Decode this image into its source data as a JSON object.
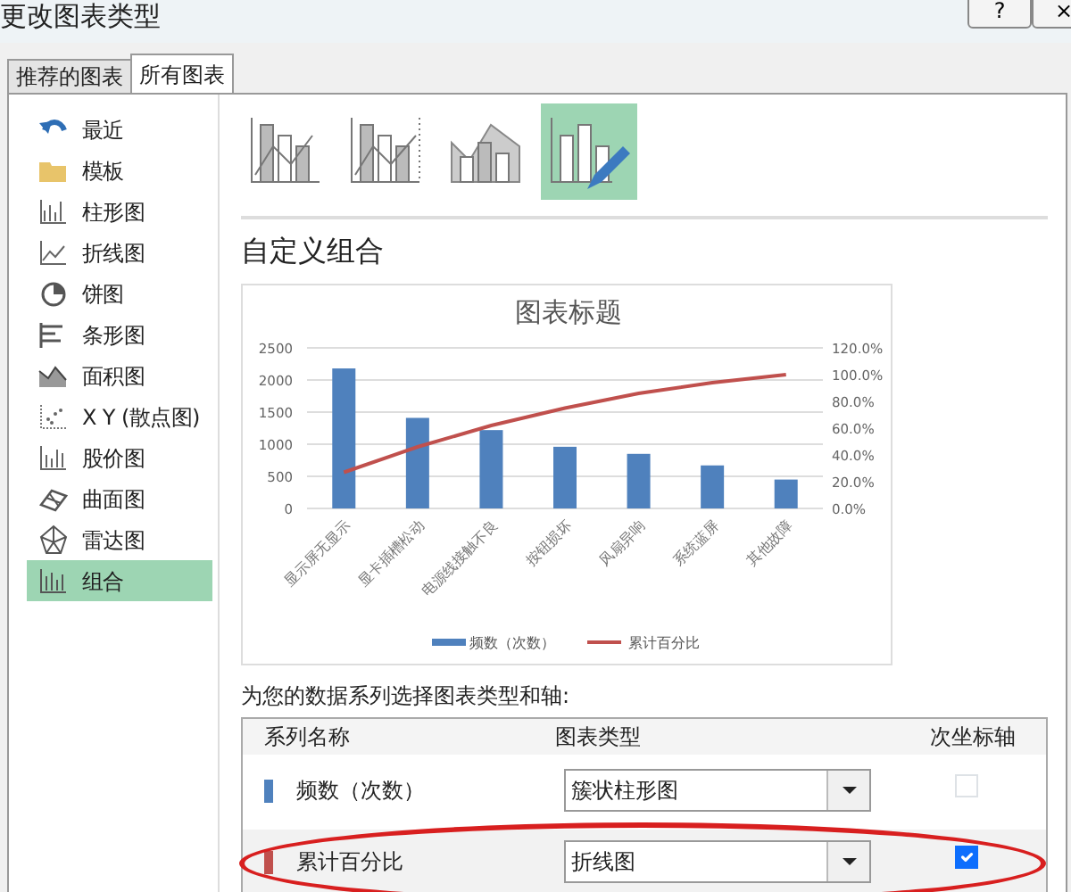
{
  "window": {
    "title": "更改图表类型",
    "buttons": [
      "?",
      "×"
    ]
  },
  "tabs": [
    {
      "label": "推荐的图表",
      "selected": false
    },
    {
      "label": "所有图表",
      "selected": true
    }
  ],
  "sidebar": {
    "items": [
      {
        "label": "最近",
        "selected": false
      },
      {
        "label": "模板",
        "selected": false
      },
      {
        "label": "柱形图",
        "selected": false
      },
      {
        "label": "折线图",
        "selected": false
      },
      {
        "label": "饼图",
        "selected": false
      },
      {
        "label": "条形图",
        "selected": false
      },
      {
        "label": "面积图",
        "selected": false
      },
      {
        "label": "X Y (散点图)",
        "selected": false
      },
      {
        "label": "股价图",
        "selected": false
      },
      {
        "label": "曲面图",
        "selected": false
      },
      {
        "label": "雷达图",
        "selected": false
      },
      {
        "label": "组合",
        "selected": true
      }
    ]
  },
  "subtypes": [
    {
      "selected": false
    },
    {
      "selected": false
    },
    {
      "selected": false
    },
    {
      "selected": true
    }
  ],
  "section_title": "自定义组合",
  "chart": {
    "chart_data": {
      "type": "bar",
      "title": "图表标题",
      "categories": [
        "显示屏无显示",
        "显卡插槽松动",
        "电源线接触不良",
        "按钮损坏",
        "风扇异响",
        "系统蓝屏",
        "其他故障"
      ],
      "series": [
        {
          "name": "频数（次数）",
          "color": "#4f81bd",
          "values": [
            2180,
            1410,
            1220,
            960,
            850,
            670,
            450
          ]
        },
        {
          "name": "累计百分比",
          "color": "#c0504d",
          "type": "line",
          "axis": "y2",
          "values": [
            0.27,
            0.46,
            0.62,
            0.75,
            0.86,
            0.94,
            1.0
          ]
        }
      ],
      "grid": true,
      "legend": "bottom",
      "ylim": [
        0,
        2500
      ],
      "yticks": [
        0,
        500,
        1000,
        1500,
        2000,
        2500
      ],
      "y2lim": [
        0,
        1.2
      ],
      "y2ticks": [
        {
          "value": 0,
          "label": "0.0%"
        },
        {
          "value": 0.2,
          "label": "20.0%"
        },
        {
          "value": 0.4,
          "label": "40.0%"
        },
        {
          "value": 0.6,
          "label": "60.0%"
        },
        {
          "value": 0.8,
          "label": "80.0%"
        },
        {
          "value": 1.0,
          "label": "100.0%"
        },
        {
          "value": 1.2,
          "label": "120.0%"
        }
      ]
    }
  },
  "series_prompt": "为您的数据系列选择图表类型和轴:",
  "table": {
    "columns": [
      "系列名称",
      "图表类型",
      "次坐标轴"
    ],
    "rows": [
      {
        "name": "频数（次数）",
        "color": "#4f81bd",
        "chart_type": "簇状柱形图",
        "secondary_axis": false,
        "highlighted": false
      },
      {
        "name": "累计百分比",
        "color": "#c0504d",
        "chart_type": "折线图",
        "secondary_axis": true,
        "highlighted": true
      }
    ]
  }
}
